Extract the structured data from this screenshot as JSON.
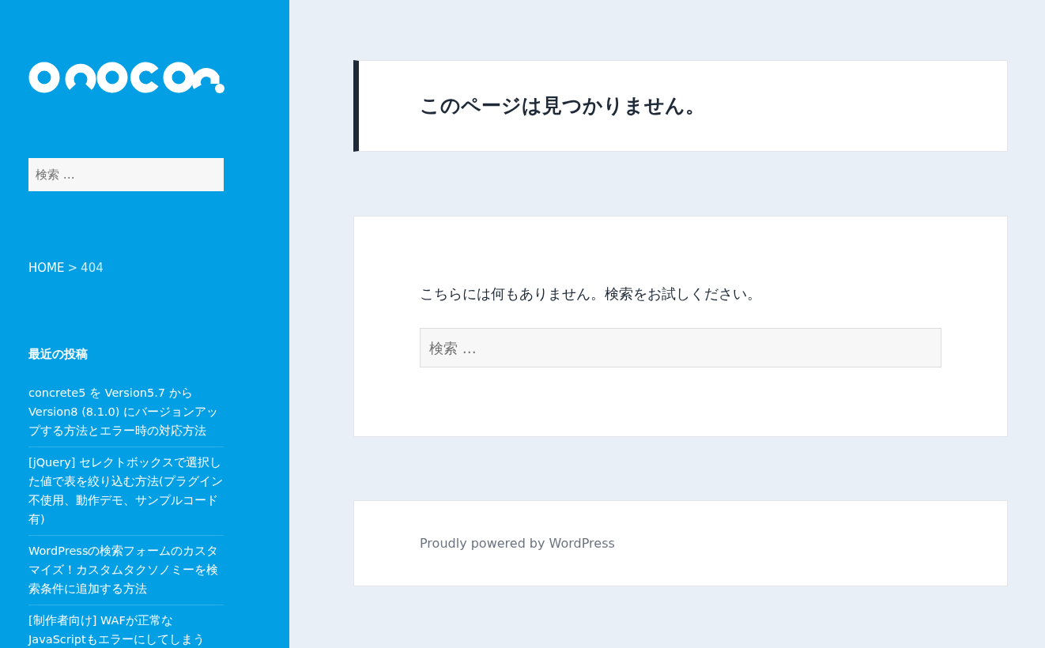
{
  "sidebar": {
    "search": {
      "placeholder": "検索 …"
    },
    "breadcrumb": {
      "home": "HOME",
      "separator": ">",
      "current": "404"
    },
    "recent_posts": {
      "title": "最近の投稿",
      "items": [
        {
          "label": "concrete5 を Version5.7 から Version8 (8.1.0) にバージョンアップする方法とエラー時の対応方法"
        },
        {
          "label": "[jQuery] セレクトボックスで選択した値で表を絞り込む方法(プラグイン不使用、動作デモ、サンプルコード有)"
        },
        {
          "label": "WordPressの検索フォームのカスタマイズ！カスタムタクソノミーを検索条件に追加する方法"
        },
        {
          "label": "[制作者向け] WAFが正常なJavaScriptもエラーにしてしまう"
        }
      ]
    }
  },
  "main": {
    "page_title": "このページは見つかりません。",
    "message": "こちらには何もありません。検索をお試しください。",
    "search": {
      "placeholder": "検索 …"
    },
    "footer": "Proudly powered by WordPress"
  }
}
